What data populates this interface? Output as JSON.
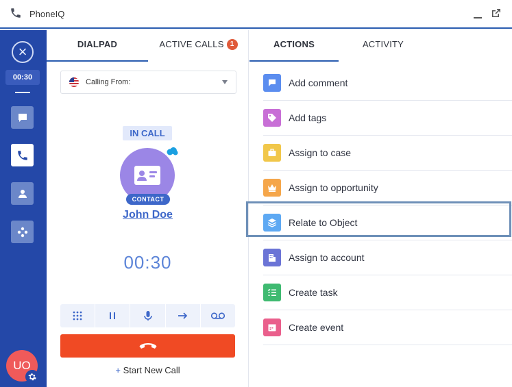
{
  "window": {
    "title": "PhoneIQ"
  },
  "rail": {
    "timer": "00:30",
    "avatar_initials": "UO",
    "nav_items": [
      "chat-icon",
      "phone-icon",
      "contact-icon",
      "apps-icon"
    ]
  },
  "dialpad": {
    "tabs": [
      {
        "label": "DIALPAD"
      },
      {
        "label": "ACTIVE CALLS",
        "badge": "1"
      }
    ],
    "calling_from_label": "Calling From:",
    "status": "IN CALL",
    "contact_tag": "CONTACT",
    "contact_name": "John Doe",
    "call_timer": "00:30",
    "new_call_plus": "+",
    "new_call_label": "Start New Call"
  },
  "actions_panel": {
    "tabs": [
      {
        "label": "ACTIONS"
      },
      {
        "label": "ACTIVITY"
      }
    ],
    "items": [
      {
        "label": "Add comment",
        "color": "#5b8def"
      },
      {
        "label": "Add tags",
        "color": "#c86fd6"
      },
      {
        "label": "Assign to case",
        "color": "#f1c74a"
      },
      {
        "label": "Assign to opportunity",
        "color": "#f5a64a"
      },
      {
        "label": "Relate to Object",
        "color": "#5ea9f3"
      },
      {
        "label": "Assign to account",
        "color": "#6b74d6"
      },
      {
        "label": "Create task",
        "color": "#3fba71"
      },
      {
        "label": "Create event",
        "color": "#ea5f8c"
      }
    ]
  },
  "colors": {
    "rail": "#2448a8",
    "accent": "#3d67c9",
    "hangup": "#f04a24",
    "avatar": "#ef5a5a",
    "badge": "#e05a3a"
  }
}
